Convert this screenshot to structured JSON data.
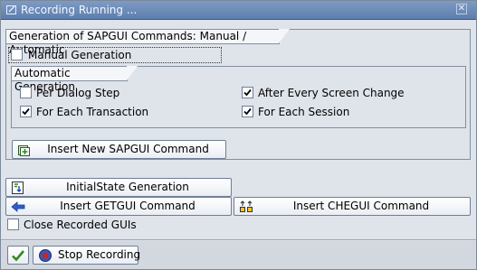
{
  "window": {
    "title": "Recording Running ...",
    "close_glyph": "✕"
  },
  "manual_auto_group": {
    "title": "Generation of SAPGUI Commands: Manual / Automatic",
    "manual_generation": {
      "label": "Manual Generation",
      "checked": false
    }
  },
  "auto_group": {
    "title": "Automatic Generation",
    "options": [
      {
        "label": "Per Dialog Step",
        "checked": false
      },
      {
        "label": "After Every Screen Change",
        "checked": true
      },
      {
        "label": "For Each Transaction",
        "checked": true
      },
      {
        "label": "For Each Session",
        "checked": true
      }
    ]
  },
  "buttons": {
    "insert_sapgui": "Insert New SAPGUI Command",
    "initial_state": "InitialState Generation",
    "insert_getgui": "Insert GETGUI Command",
    "insert_chegui": "Insert CHEGUI Command"
  },
  "close_recorded_guis": {
    "label": "Close Recorded GUIs",
    "checked": false
  },
  "footer": {
    "stop_recording": "Stop Recording"
  },
  "icons": {
    "title": "window-icon",
    "insert_sapgui": "insert-command-icon",
    "initial_state": "initial-state-icon",
    "insert_getgui": "arrow-left-icon",
    "insert_chegui": "compare-icon",
    "confirm": "checkmark-icon",
    "stop": "stop-record-icon"
  },
  "colors": {
    "title_bar": "#6c8ab8",
    "panel": "#dfe3ea",
    "check": "#000000",
    "confirm_green": "#2f8a1e",
    "stop_red": "#c0282a"
  }
}
